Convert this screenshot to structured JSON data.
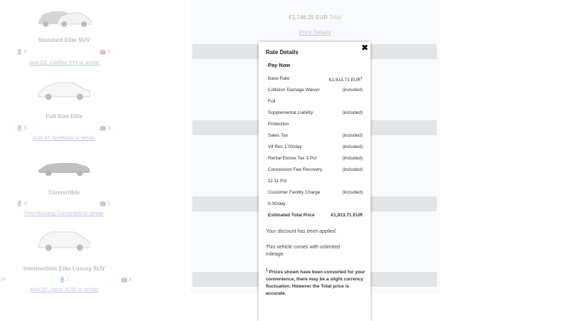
{
  "vehicles": [
    {
      "name": "Standard Elite SUV",
      "passengers": "5",
      "bags": "3",
      "link": "Audi Q3, Cadillac XT4 or similar"
    },
    {
      "name": "Full Size Elite",
      "passengers": "5",
      "bags": "3",
      "link": "Audi A5 Sportback or similar"
    },
    {
      "name": "Convertible",
      "passengers": "4",
      "bags": "2",
      "link": "Ford Mustang Convertible or similar"
    },
    {
      "name": "Intermediate Elite Luxury SUV",
      "extra": "14",
      "passengers": "7",
      "bags": "4",
      "link": "Audi Q7, Volvo XC90 or similar"
    }
  ],
  "summary": {
    "total_amount": "€1,746.25 EUR",
    "total_label": "Total",
    "price_details_link": "Price Details"
  },
  "modal": {
    "title": "Rate Details",
    "close_symbol": "✖",
    "section": "Pay Now",
    "rows": [
      {
        "label": "Base Rate",
        "value": "€1,913.71 EUR",
        "value_sup": "1"
      },
      {
        "label": "Collision Damage Waiver",
        "value": "(included)"
      },
      {
        "label": "Full",
        "value": ""
      },
      {
        "label": "Supplemental Liability",
        "value": "(included)"
      },
      {
        "label": "Protection",
        "value": ""
      },
      {
        "label": "Sales Tax",
        "value": "(included)"
      },
      {
        "label": "Vlf Rec 1.00/day",
        "value": "(included)"
      },
      {
        "label": "Rental Excise Tax 3 Pct",
        "value": "(included)"
      },
      {
        "label": "Concession Fee Recovery",
        "value": "(included)"
      },
      {
        "label": "11.11 Pct",
        "value": ""
      },
      {
        "label": "Customer Facility Charge",
        "value": "(included)"
      },
      {
        "label": "5.00/day",
        "value": ""
      }
    ],
    "total_row": {
      "label": "Estimated Total Price",
      "value": "€1,913.71 EUR"
    },
    "discount_note": "Your discount has been applied.",
    "mileage_note": "This vehicle comes with unlimited mileage.",
    "footnote_marker": "1",
    "footnote_text": "Prices shown have been converted for your convenience, there may be a slight currency fluctuation. However the Total price is accurate."
  }
}
